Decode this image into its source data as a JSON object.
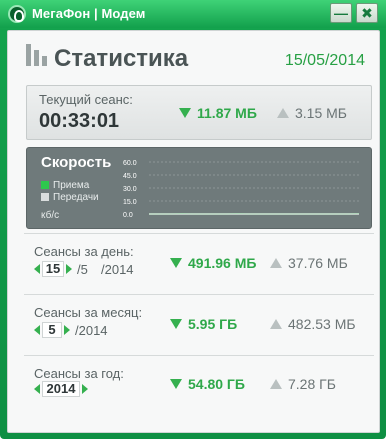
{
  "app": {
    "title": "МегаФон | Модем",
    "min_symbol": "—",
    "close_symbol": "✖"
  },
  "header": {
    "title": "Статистика",
    "date": "15/05/2014"
  },
  "session": {
    "label": "Текущий сеанс:",
    "time": "00:33:01",
    "download": "11.87 МБ",
    "upload": "3.15 МБ"
  },
  "speed": {
    "title": "Скорость",
    "legend_receive": "Приема",
    "legend_send": "Передачи",
    "unit": "кб/с",
    "colors": {
      "receive": "#2ec74d",
      "send": "#d9dddd"
    }
  },
  "chart_data": {
    "type": "line",
    "ylim": [
      0,
      60
    ],
    "yticks": [
      "60.0",
      "45.0",
      "30.0",
      "15.0",
      "0.0"
    ],
    "series": [
      {
        "name": "Приема",
        "values": [
          0,
          0,
          0,
          0.3,
          0,
          0,
          0,
          0,
          0.2,
          0,
          0,
          0,
          0,
          0,
          0,
          0,
          0,
          0,
          0,
          0.4
        ]
      },
      {
        "name": "Передачи",
        "values": [
          0,
          0,
          0,
          0,
          0,
          0,
          0,
          0,
          0,
          0,
          0,
          0,
          0,
          0,
          0,
          0,
          0,
          0,
          0,
          0
        ]
      }
    ]
  },
  "day": {
    "label": "Сеансы за день:",
    "day": "15",
    "month": "/5",
    "year": "/2014",
    "download": "491.96 МБ",
    "upload": "37.76 МБ"
  },
  "month": {
    "label": "Сеансы за месяц:",
    "month": "5",
    "year": "/2014",
    "download": "5.95 ГБ",
    "upload": "482.53 МБ"
  },
  "year": {
    "label": "Сеансы за год:",
    "year": "2014",
    "download": "54.80 ГБ",
    "upload": "7.28 ГБ"
  }
}
